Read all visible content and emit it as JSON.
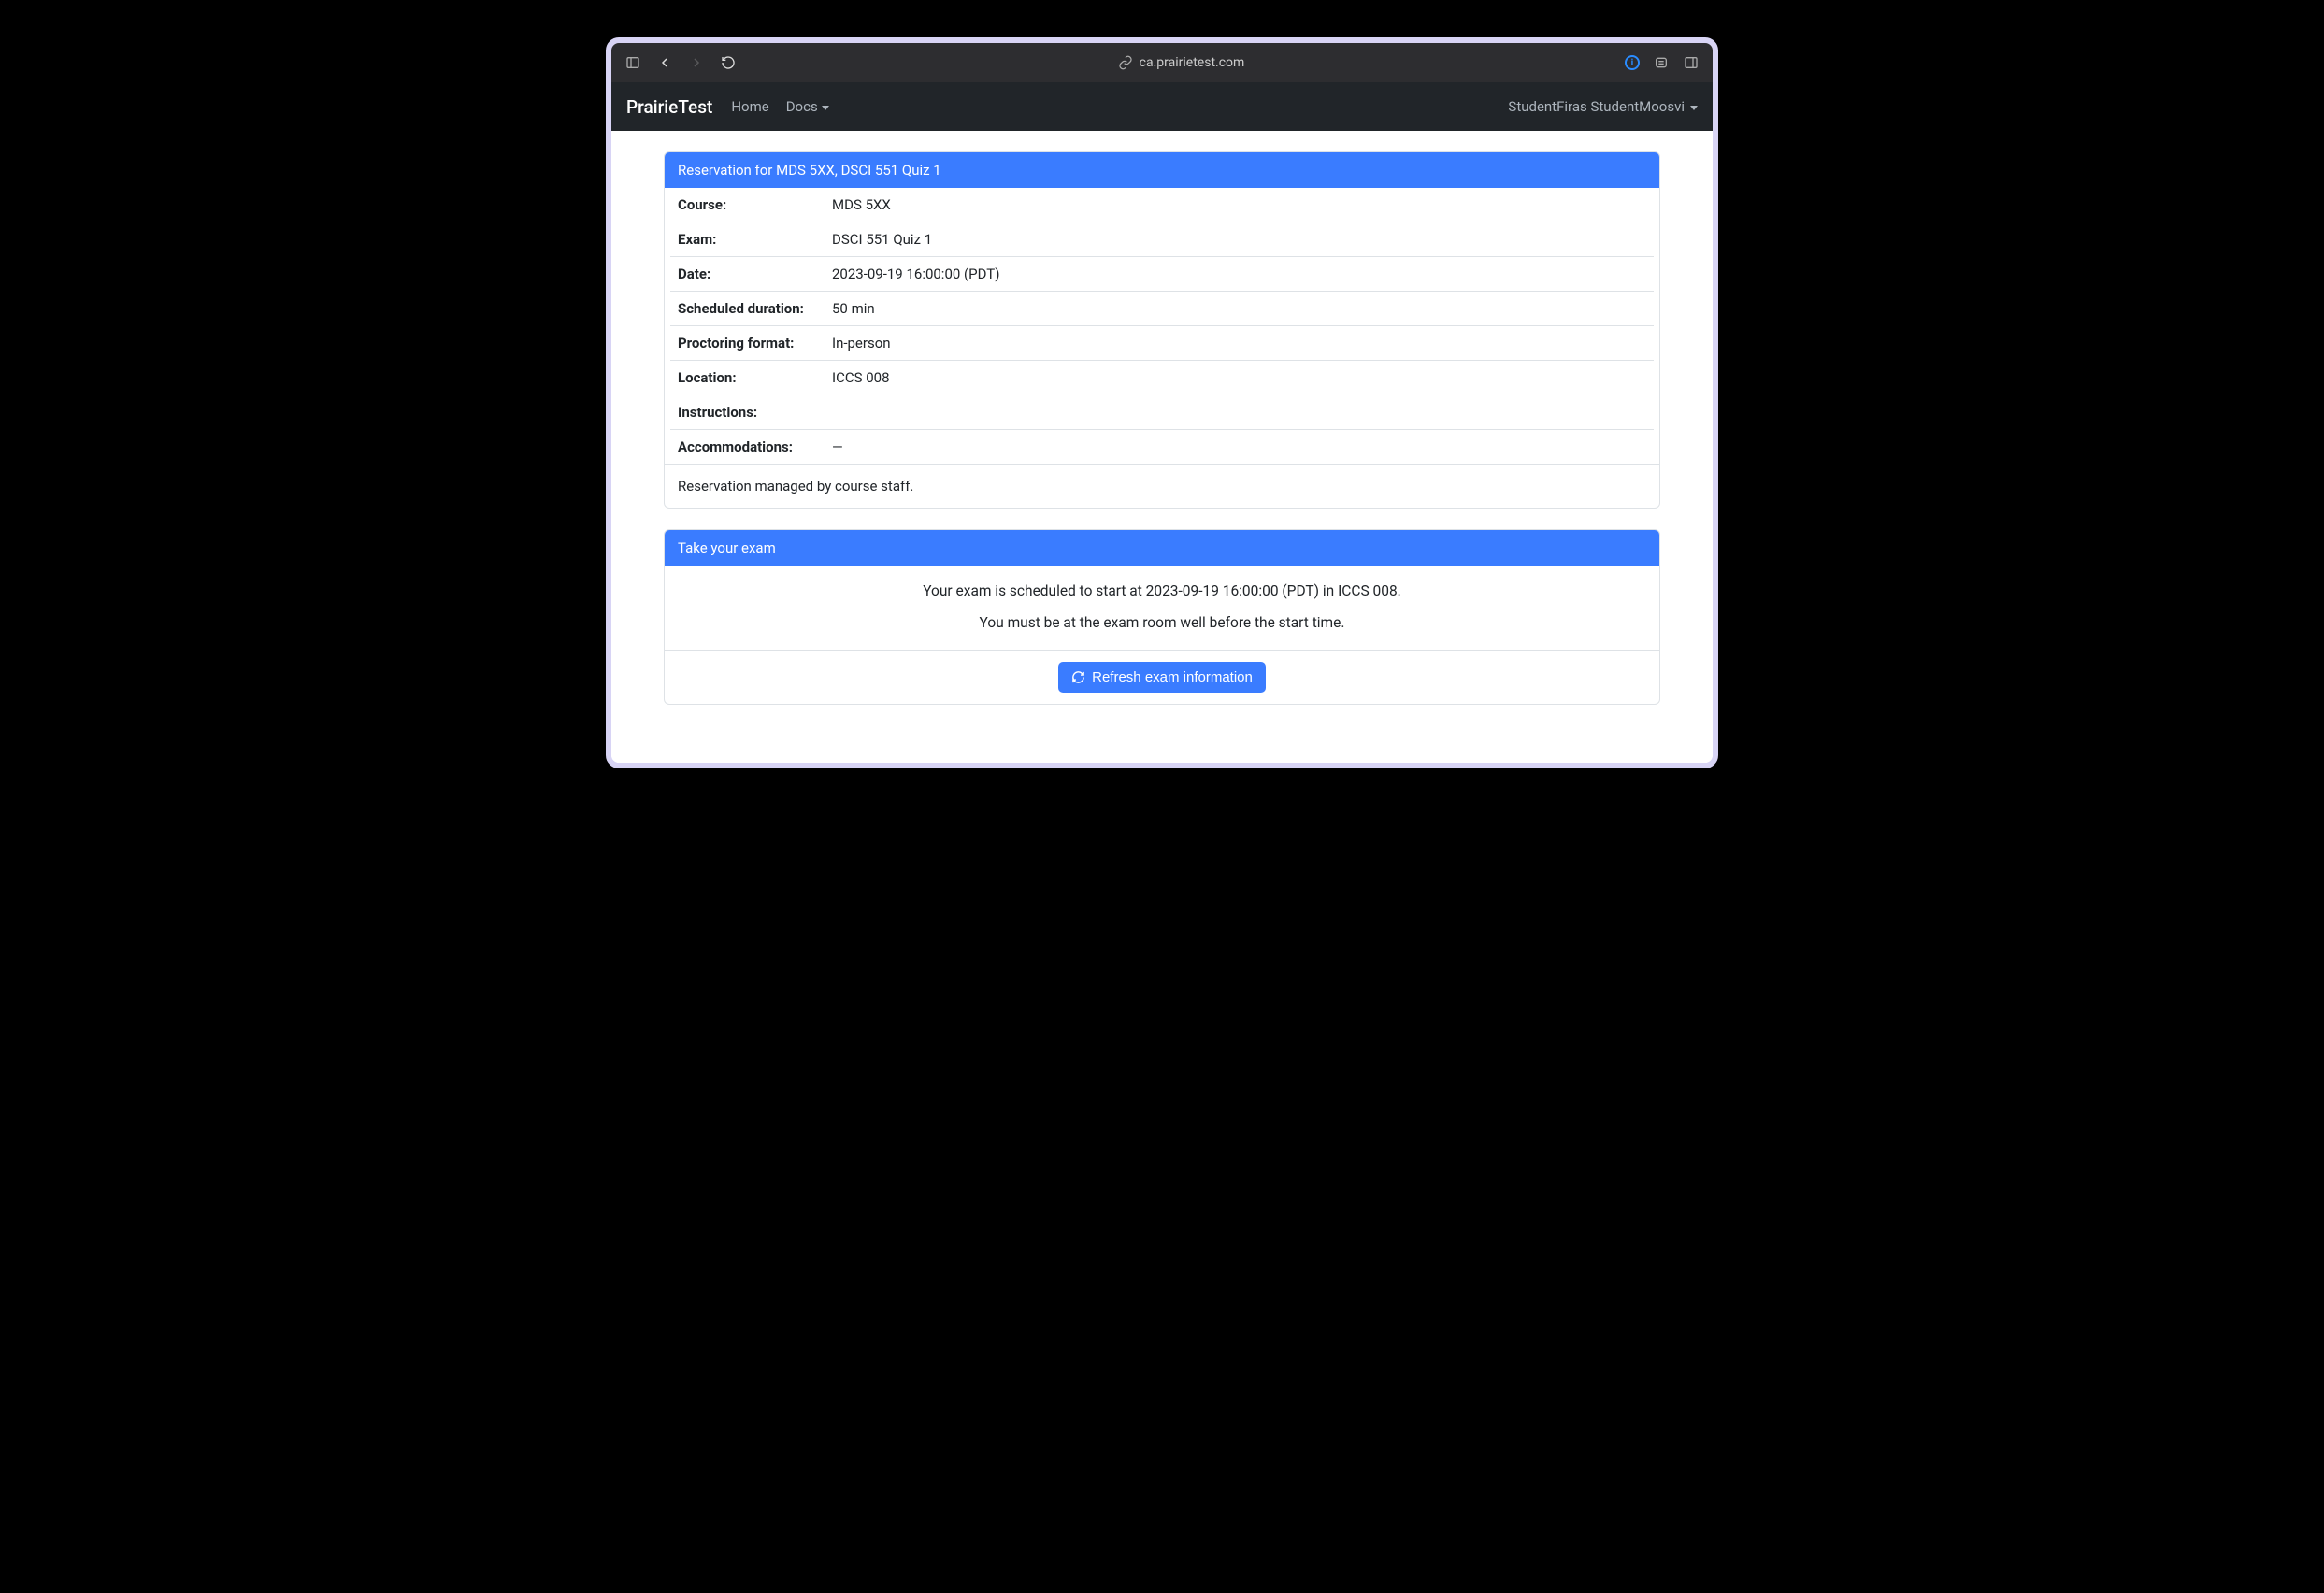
{
  "browser": {
    "url": "ca.prairietest.com"
  },
  "navbar": {
    "brand": "PrairieTest",
    "links": {
      "home": "Home",
      "docs": "Docs"
    },
    "user_name": "StudentFiras StudentMoosvi"
  },
  "reservation_card": {
    "header": "Reservation for MDS 5XX, DSCI 551 Quiz 1",
    "rows": {
      "course": {
        "label": "Course:",
        "value": "MDS 5XX"
      },
      "exam": {
        "label": "Exam:",
        "value": "DSCI 551 Quiz 1"
      },
      "date": {
        "label": "Date:",
        "value": "2023-09-19 16:00:00 (PDT)"
      },
      "duration": {
        "label": "Scheduled duration:",
        "value": "50 min"
      },
      "proctoring": {
        "label": "Proctoring format:",
        "value": "In-person"
      },
      "location": {
        "label": "Location:",
        "value": "ICCS 008"
      },
      "instructions": {
        "label": "Instructions:",
        "value": ""
      },
      "accommodations": {
        "label": "Accommodations:",
        "value": "—"
      }
    },
    "footer": "Reservation managed by course staff."
  },
  "exam_card": {
    "header": "Take your exam",
    "line1": "Your exam is scheduled to start at 2023-09-19 16:00:00 (PDT) in ICCS 008.",
    "line2": "You must be at the exam room well before the start time.",
    "refresh_button": "Refresh exam information"
  }
}
